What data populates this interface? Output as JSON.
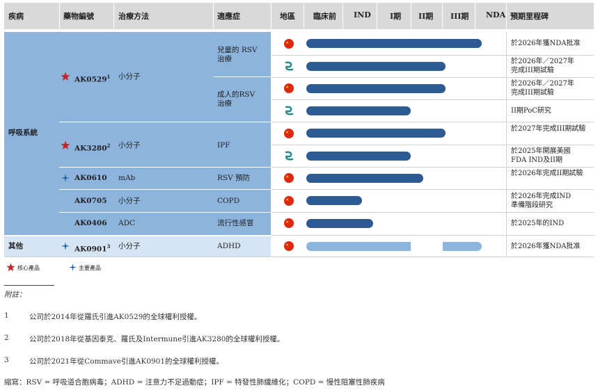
{
  "headers": {
    "disease": "疾病",
    "drug": "藥物編號",
    "method": "治療方法",
    "indication": "適應症",
    "region": "地區",
    "preclinical": "臨床前",
    "ind": "IND",
    "phase1": "I期",
    "phase2": "II期",
    "phase3": "III期",
    "nda": "NDA",
    "milestone": "預期里程碑"
  },
  "groups": {
    "respiratory": "呼吸系統",
    "other": "其他"
  },
  "drugs": {
    "d1": {
      "name": "AK0529",
      "sup": "1",
      "method": "小分子"
    },
    "d2": {
      "name": "AK3280",
      "sup": "2",
      "method": "小分子"
    },
    "d3": {
      "name": "AK0610",
      "method": "mAb"
    },
    "d4": {
      "name": "AK0705",
      "method": "小分子"
    },
    "d5": {
      "name": "AK0406",
      "method": "ADC"
    },
    "d6": {
      "name": "AK0901",
      "sup": "3",
      "method": "小分子"
    }
  },
  "indications": {
    "i1a": "兒童的 RSV",
    "i1b": "治療",
    "i2a": "成人的RSV",
    "i2b": "治療",
    "i3": "IPF",
    "i4": "RSV 預防",
    "i5": "COPD",
    "i6": "流行性感冒",
    "i7": "ADHD"
  },
  "rows": [
    {
      "region": "china",
      "progress": "NDA",
      "milestone": [
        "於2026年獲NDA批准"
      ]
    },
    {
      "region": "global",
      "progress": "III期",
      "milestone": [
        "於2026年／2027年",
        "完成III期試驗"
      ]
    },
    {
      "region": "china",
      "progress": "III期",
      "milestone": [
        "於2026年／2027年",
        "完成III期試驗"
      ]
    },
    {
      "region": "global",
      "progress": "II期",
      "milestone": [
        "II期PoC研究"
      ]
    },
    {
      "region": "china",
      "progress": "III期",
      "milestone": [
        "於2027年完成III期試驗"
      ]
    },
    {
      "region": "global",
      "progress": "II期",
      "milestone": [
        "於2025年開展美國",
        "FDA IND及II期"
      ]
    },
    {
      "region": "china",
      "progress": "II期",
      "milestone": [
        "於2026年完成II期試驗"
      ]
    },
    {
      "region": "china",
      "progress": "IND",
      "milestone": [
        "於2026年完成IND",
        "準備階段研究"
      ]
    },
    {
      "region": "china",
      "progress": "IND",
      "milestone": [
        "於2025年的IND"
      ]
    },
    {
      "region": "china",
      "progress": "NDA",
      "milestone": [
        "於2026年獲NDA批准"
      ]
    }
  ],
  "legend": {
    "core": "核心產品",
    "key": "主要產品"
  },
  "notes": {
    "title": "附註：",
    "n1_num": "1",
    "n1": "公司於2014年從羅氏引進AK0529的全球權利授權。",
    "n2_num": "2",
    "n2": "公司於2018年從基因泰克、羅氏及Intermune引進AK3280的全球權利授權。",
    "n3_num": "3",
    "n3": "公司於2021年從Commave引進AK0901的全球權利授權。",
    "abbr": "縮寫：RSV = 呼吸道合胞病毒；ADHD = 注意力不足過動症；IPF = 特發性肺纖維化；COPD = 慢性阻塞性肺疾病"
  },
  "colors": {
    "bar_dark": "#2e5a94",
    "bar_light": "#8cb4dc",
    "group_bg": "#8cb4dc",
    "other_bg": "#d6e5f3",
    "header_bg": "#d9d9d9",
    "china_flag": "#de2910",
    "global_icon": "#2e8b8b",
    "core_star": "#c0282d",
    "key_star": "#1f5fa8"
  }
}
